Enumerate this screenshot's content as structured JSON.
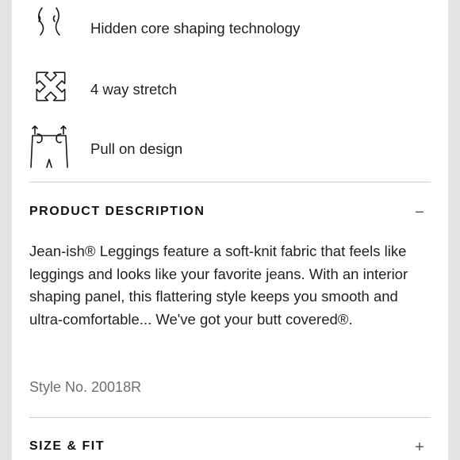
{
  "features": [
    {
      "icon": "shaping-curves-icon",
      "label": "Hidden core shaping technology"
    },
    {
      "icon": "four-way-arrows-icon",
      "label": "4 way stretch"
    },
    {
      "icon": "pull-on-pants-icon",
      "label": "Pull on design"
    }
  ],
  "product_description": {
    "title": "PRODUCT DESCRIPTION",
    "toggle": "−",
    "state": "expanded",
    "body": "Jean-ish® Leggings feature a soft-knit fabric that feels like leggings and looks like your favorite jeans. With an interior shaping panel, this flattering style keeps you smooth and ultra-comfortable... We've got your butt covered®.",
    "style_number": "Style No. 20018R"
  },
  "size_fit": {
    "title": "SIZE & FIT",
    "toggle": "+",
    "state": "collapsed"
  },
  "colors": {
    "text": "#1c1c1c",
    "muted": "#6f6f6f",
    "divider": "#cfcfcf",
    "background": "#ffffff"
  }
}
